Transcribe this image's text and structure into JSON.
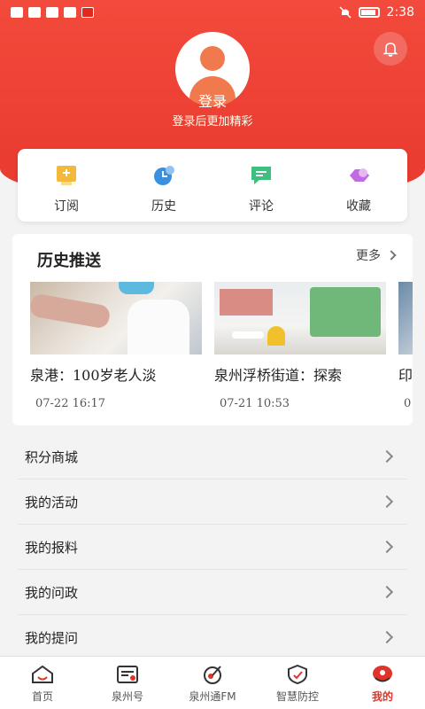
{
  "status_bar": {
    "time": "2:38"
  },
  "profile": {
    "login_label": "登录",
    "login_subtitle": "登录后更加精彩"
  },
  "quick_actions": [
    {
      "label": "订阅",
      "icon": "subscribe-icon",
      "color": "#f4b93a"
    },
    {
      "label": "历史",
      "icon": "history-clock-icon",
      "color": "#3a8fe0"
    },
    {
      "label": "评论",
      "icon": "comment-icon",
      "color": "#3fbf7f"
    },
    {
      "label": "收藏",
      "icon": "favorite-icon",
      "color": "#c06be0"
    }
  ],
  "history": {
    "title": "历史推送",
    "more_label": "更多",
    "items": [
      {
        "caption": "泉港：100岁老人淡",
        "time": "07-22 16:17"
      },
      {
        "caption": "泉州浮桥街道：探索",
        "time": "07-21 10:53"
      },
      {
        "caption": "印",
        "time": "0"
      }
    ]
  },
  "menu": [
    {
      "label": "积分商城"
    },
    {
      "label": "我的活动"
    },
    {
      "label": "我的报料"
    },
    {
      "label": "我的问政"
    },
    {
      "label": "我的提问"
    }
  ],
  "tabbar": [
    {
      "label": "首页",
      "icon": "home-icon",
      "active": false
    },
    {
      "label": "泉州号",
      "icon": "quanzhou-account-icon",
      "active": false
    },
    {
      "label": "泉州通FM",
      "icon": "radio-fm-icon",
      "active": false
    },
    {
      "label": "智慧防控",
      "icon": "shield-icon",
      "active": false
    },
    {
      "label": "我的",
      "icon": "my-profile-icon",
      "active": true
    }
  ],
  "colors": {
    "brand_red": "#e8392e",
    "active_tab": "#e0332a"
  }
}
